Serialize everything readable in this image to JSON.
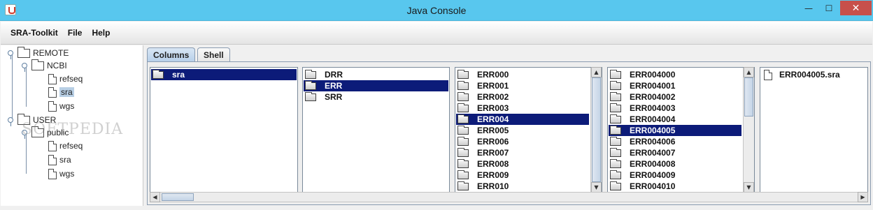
{
  "window": {
    "title": "Java Console",
    "controls": {
      "minimize": "—",
      "maximize": "☐",
      "close": "✕"
    }
  },
  "menubar": {
    "items": [
      "SRA-Toolkit",
      "File",
      "Help"
    ]
  },
  "tree": {
    "nodes": [
      {
        "label": "REMOTE",
        "type": "folder"
      },
      {
        "label": "NCBI",
        "type": "folder"
      },
      {
        "label": "refseq",
        "type": "file"
      },
      {
        "label": "sra",
        "type": "file",
        "selected": true
      },
      {
        "label": "wgs",
        "type": "file"
      },
      {
        "label": "USER",
        "type": "folder"
      },
      {
        "label": "public",
        "type": "folder"
      },
      {
        "label": "refseq",
        "type": "file"
      },
      {
        "label": "sra",
        "type": "file"
      },
      {
        "label": "wgs",
        "type": "file"
      }
    ]
  },
  "tabs": [
    {
      "label": "Columns",
      "active": true
    },
    {
      "label": "Shell",
      "active": false
    }
  ],
  "columns": [
    {
      "items": [
        "sra"
      ],
      "selected": 0
    },
    {
      "items": [
        "DRR",
        "ERR",
        "SRR"
      ],
      "selected": 1
    },
    {
      "items": [
        "ERR000",
        "ERR001",
        "ERR002",
        "ERR003",
        "ERR004",
        "ERR005",
        "ERR006",
        "ERR007",
        "ERR008",
        "ERR009",
        "ERR010"
      ],
      "selected": 4
    },
    {
      "items": [
        "ERR004000",
        "ERR004001",
        "ERR004002",
        "ERR004003",
        "ERR004004",
        "ERR004005",
        "ERR004006",
        "ERR004007",
        "ERR004008",
        "ERR004009",
        "ERR004010"
      ],
      "selected": 5
    },
    {
      "items": [
        "ERR004005.sra"
      ],
      "selected": -1,
      "file": true
    }
  ],
  "watermark": "SOFTPEDIA"
}
